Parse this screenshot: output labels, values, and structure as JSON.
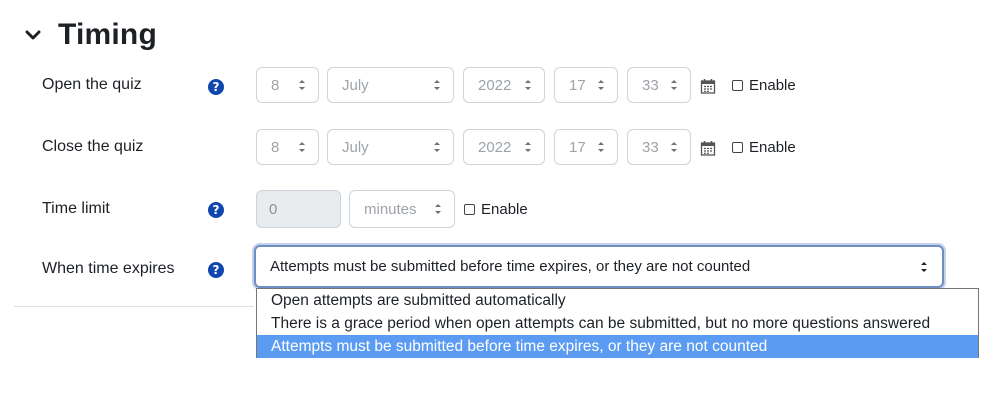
{
  "section": {
    "title": "Timing",
    "expanded": true
  },
  "open_quiz": {
    "label": "Open the quiz",
    "day": "8",
    "month": "July",
    "year": "2022",
    "hour": "17",
    "minute": "33",
    "enable_label": "Enable",
    "enabled": false
  },
  "close_quiz": {
    "label": "Close the quiz",
    "day": "8",
    "month": "July",
    "year": "2022",
    "hour": "17",
    "minute": "33",
    "enable_label": "Enable",
    "enabled": false
  },
  "time_limit": {
    "label": "Time limit",
    "value": "0",
    "unit": "minutes",
    "enable_label": "Enable",
    "enabled": false
  },
  "when_expires": {
    "label": "When time expires",
    "selected": "Attempts must be submitted before time expires, or they are not counted",
    "options": [
      "Open attempts are submitted automatically",
      "There is a grace period when open attempts can be submitted, but no more questions answered",
      "Attempts must be submitted before time expires, or they are not counted"
    ],
    "selected_index": 2
  },
  "colors": {
    "help_icon": "#0f47ad",
    "selected_option": "#5b9cf2",
    "focus_border": "#6f8fc4"
  }
}
